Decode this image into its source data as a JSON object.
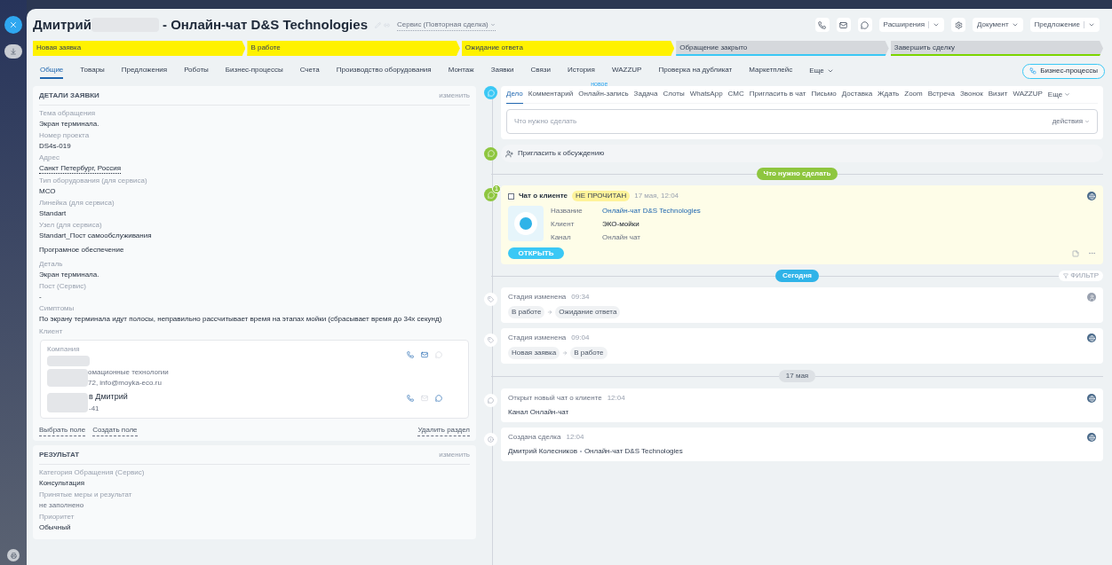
{
  "header": {
    "title": "Дмитрий",
    "title_rest": "- Онлайн-чат D&S Technologies",
    "category": "Сервис (Повторная сделка)",
    "buttons": [
      {
        "kind": "phone"
      },
      {
        "kind": "mail"
      },
      {
        "kind": "chat"
      },
      {
        "kind": "split",
        "label": "Расширения"
      },
      {
        "kind": "settings"
      },
      {
        "kind": "dropdown",
        "label": "Документ"
      },
      {
        "kind": "split",
        "label": "Предложение"
      }
    ]
  },
  "stages": [
    {
      "label": "Новая заявка",
      "color": "#fff200",
      "reached": true
    },
    {
      "label": "В работе",
      "color": "#fff200",
      "reached": true
    },
    {
      "label": "Ожидание ответа",
      "color": "#fff200",
      "reached": true
    },
    {
      "label": "Обращение закрыто",
      "color": "#3bc8f5",
      "reached": false
    },
    {
      "label": "Завершить сделку",
      "color": "#7bd500",
      "reached": false
    }
  ],
  "tabs": [
    {
      "label": "Общие",
      "selected": true
    },
    {
      "label": "Товары",
      "selected": false
    },
    {
      "label": "Предложения",
      "selected": false
    },
    {
      "label": "Роботы",
      "selected": false
    },
    {
      "label": "Бизнес-процессы",
      "selected": false
    },
    {
      "label": "Счета",
      "selected": false
    },
    {
      "label": "Производство оборудования",
      "selected": false
    },
    {
      "label": "Монтаж",
      "selected": false
    },
    {
      "label": "Заявки",
      "selected": false
    },
    {
      "label": "Связи",
      "selected": false
    },
    {
      "label": "История",
      "selected": false
    },
    {
      "label": "WAZZUP",
      "selected": false
    },
    {
      "label": "Проверка на дубликат",
      "selected": false
    },
    {
      "label": "Маркетплейс",
      "selected": false
    }
  ],
  "more_tab": "Еще",
  "bp_button": "Бизнес-процессы",
  "details": {
    "title": "ДЕТАЛИ ЗАЯВКИ",
    "edit": "изменить",
    "fields": [
      {
        "kind": "text",
        "label": "Тема обращения",
        "value": "Экран терминала."
      },
      {
        "kind": "text",
        "label": "Номер проекта",
        "value": "DS4s-019"
      },
      {
        "kind": "address",
        "label": "Адрес",
        "value": "Санкт Петербург, Россия"
      },
      {
        "kind": "text",
        "label": "Тип оборудования (для сервиса)",
        "value": "МСО"
      },
      {
        "kind": "text",
        "label": "Линейка (для сервиса)",
        "value": "Standart"
      },
      {
        "kind": "text",
        "label": "Узел (для сервиса)",
        "value": "Standart_Пост самообслуживания"
      },
      {
        "kind": "plain",
        "value": "Програмное обеспечение"
      },
      {
        "kind": "text",
        "label": "Деталь",
        "value": "Экран терминала."
      },
      {
        "kind": "text",
        "label": "Пост (Сервис)",
        "value": "-"
      },
      {
        "kind": "text",
        "label": "Симптомы",
        "value": "По экрану терминала идут полосы, неправильно рассчитывает время на этапах мойки (сбрасывает время до 34х секунд)"
      }
    ],
    "client": {
      "label": "Клиент",
      "company_label": "Компания",
      "company_lines": [
        "омационные технологии",
        "72, info@moyka-eco.ru"
      ],
      "contact_name": "в Дмитрий",
      "contact_phone": "-41"
    },
    "links": [
      "Выбрать поле",
      "Создать поле"
    ],
    "remove": "Удалить раздел"
  },
  "result": {
    "title": "РЕЗУЛЬТАТ",
    "edit": "изменить",
    "fields": [
      {
        "kind": "text",
        "label": "Категория Обращения (Сервис)",
        "value": "Консультация"
      },
      {
        "kind": "empty",
        "label": "Принятые меры и результат",
        "value": "не заполнено"
      },
      {
        "kind": "text",
        "label": "Приоритет",
        "value": "Обычный"
      }
    ]
  },
  "activity": {
    "tabs": [
      {
        "label": "Дело",
        "selected": true
      },
      {
        "label": "Комментарий",
        "selected": false
      },
      {
        "label": "Онлайн-запись",
        "selected": false,
        "badge": "новое"
      },
      {
        "label": "Задача",
        "selected": false
      },
      {
        "label": "Слоты",
        "selected": false
      },
      {
        "label": "WhatsApp",
        "selected": false
      },
      {
        "label": "СМС",
        "selected": false
      },
      {
        "label": "Пригласить в чат",
        "selected": false
      },
      {
        "label": "Письмо",
        "selected": false
      },
      {
        "label": "Доставка",
        "selected": false
      },
      {
        "label": "Ждать",
        "selected": false
      },
      {
        "label": "Zoom",
        "selected": false
      },
      {
        "label": "Встреча",
        "selected": false
      },
      {
        "label": "Звонок",
        "selected": false
      },
      {
        "label": "Визит",
        "selected": false
      },
      {
        "label": "WAZZUP",
        "selected": false
      }
    ],
    "more": "Еще",
    "placeholder": "Что нужно сделать",
    "actions": "действия"
  },
  "invite": "Пригласить к обсуждению",
  "planned_divider": "Что нужно сделать",
  "chat_card": {
    "title": "Чат о клиенте",
    "checked": false,
    "badge": "НЕ ПРОЧИТАН",
    "time": "17 мая, 12:04",
    "counter": "1",
    "rows": [
      {
        "label": "Название",
        "value": "Онлайн-чат D&S Technologies",
        "kind": "link"
      },
      {
        "label": "Клиент",
        "value": "ЭКО-мойки",
        "kind": "strong"
      },
      {
        "label": "Канал",
        "value": "Онлайн чат",
        "kind": "muted"
      }
    ],
    "button": "ОТКРЫТЬ"
  },
  "today_divider": "Сегодня",
  "filter": "ФИЛЬТР",
  "history": [
    {
      "kind": "stage",
      "title": "Стадия изменена",
      "time": "09:34",
      "from": "В работе",
      "to": "Ожидание ответа",
      "user_avatar": true
    },
    {
      "kind": "stage",
      "title": "Стадия изменена",
      "time": "09:04",
      "from": "Новая заявка",
      "to": "В работе",
      "user_avatar": false
    },
    {
      "kind": "divider",
      "label": "17 мая"
    },
    {
      "kind": "chat",
      "title": "Открыт новый чат о клиенте",
      "time": "12:04",
      "text": "Канал Онлайн-чат",
      "user_avatar": false
    },
    {
      "kind": "deal",
      "title": "Создана сделка",
      "time": "12:04",
      "author": "Дмитрий Колесников",
      "text": "Онлайн-чат D&S Technologies",
      "user_avatar": false
    }
  ]
}
